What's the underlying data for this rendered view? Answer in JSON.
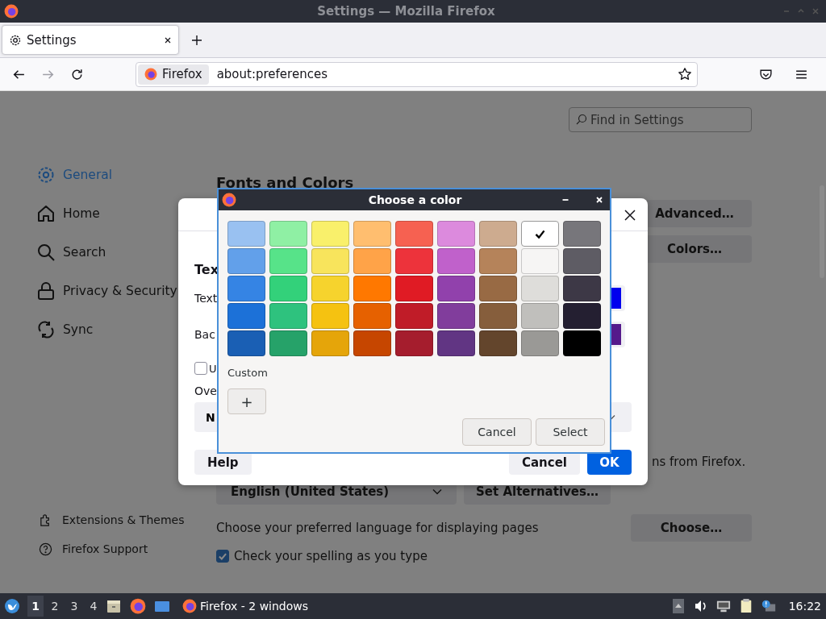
{
  "window": {
    "title": "Settings — Mozilla Firefox"
  },
  "tabs": [
    {
      "label": "Settings",
      "selected": true
    }
  ],
  "navigation": {
    "forward_disabled": true
  },
  "url_bar": {
    "identity": "Firefox",
    "value": "about:preferences"
  },
  "search": {
    "placeholder": "Find in Settings"
  },
  "sidebar": {
    "items": [
      {
        "label": "General",
        "kind": "gear",
        "selected": true
      },
      {
        "label": "Home",
        "kind": "home",
        "selected": false
      },
      {
        "label": "Search",
        "kind": "search",
        "selected": false
      },
      {
        "label": "Privacy & Security",
        "kind": "lock",
        "selected": false
      },
      {
        "label": "Sync",
        "kind": "sync",
        "selected": false
      }
    ],
    "footer": [
      {
        "label": "Extensions & Themes",
        "kind": "puzzle"
      },
      {
        "label": "Firefox Support",
        "kind": "help"
      }
    ]
  },
  "content": {
    "heading": "Fonts and Colors",
    "side_buttons": [
      "Advanced…",
      "Colors…"
    ],
    "partial_text": "ns from Firefox.",
    "language_dropdown": "English (United States)",
    "alternatives_button": "Set Alternatives…",
    "language_prompt": "Choose your preferred language for displaying pages",
    "choose_button": "Choose…",
    "spellcheck": {
      "label": "Check your spelling as you type",
      "checked": true
    }
  },
  "fonts_dialog": {
    "heading": "Tex",
    "color_rows": [
      {
        "label": "Text",
        "color": "#0000ee"
      },
      {
        "label": "Bac",
        "color": "#551a8b"
      }
    ],
    "checkbox": {
      "label": "U",
      "checked": false
    },
    "override_label": "Ove",
    "override_select": "N",
    "help": "Help",
    "cancel": "Cancel",
    "ok": "OK"
  },
  "color_chooser": {
    "title": "Choose a color",
    "swatch_rows": [
      [
        {
          "color": "#99c1f1",
          "selected": false
        },
        {
          "color": "#8ff0a4",
          "selected": false
        },
        {
          "color": "#f9f06b",
          "selected": false
        },
        {
          "color": "#ffbe6f",
          "selected": false
        },
        {
          "color": "#f66151",
          "selected": false
        },
        {
          "color": "#dc8add",
          "selected": false
        },
        {
          "color": "#cdab8f",
          "selected": false
        },
        {
          "color": "#ffffff",
          "selected": true
        },
        {
          "color": "#77767b",
          "selected": false
        }
      ],
      [
        {
          "color": "#62a0ea",
          "selected": false
        },
        {
          "color": "#57e389",
          "selected": false
        },
        {
          "color": "#f8e45c",
          "selected": false
        },
        {
          "color": "#ffa348",
          "selected": false
        },
        {
          "color": "#ed333b",
          "selected": false
        },
        {
          "color": "#c061cb",
          "selected": false
        },
        {
          "color": "#b5835a",
          "selected": false
        },
        {
          "color": "#f6f5f4",
          "selected": false
        },
        {
          "color": "#5e5c64",
          "selected": false
        }
      ],
      [
        {
          "color": "#3584e4",
          "selected": false
        },
        {
          "color": "#33d17a",
          "selected": false
        },
        {
          "color": "#f6d32d",
          "selected": false
        },
        {
          "color": "#ff7800",
          "selected": false
        },
        {
          "color": "#e01b24",
          "selected": false
        },
        {
          "color": "#9141ac",
          "selected": false
        },
        {
          "color": "#986a44",
          "selected": false
        },
        {
          "color": "#deddda",
          "selected": false
        },
        {
          "color": "#3d3846",
          "selected": false
        }
      ],
      [
        {
          "color": "#1c71d8",
          "selected": false
        },
        {
          "color": "#2ec27e",
          "selected": false
        },
        {
          "color": "#f5c211",
          "selected": false
        },
        {
          "color": "#e66100",
          "selected": false
        },
        {
          "color": "#c01c28",
          "selected": false
        },
        {
          "color": "#813d9c",
          "selected": false
        },
        {
          "color": "#865e3c",
          "selected": false
        },
        {
          "color": "#c0bfbc",
          "selected": false
        },
        {
          "color": "#241f31",
          "selected": false
        }
      ],
      [
        {
          "color": "#1a5fb4",
          "selected": false
        },
        {
          "color": "#26a269",
          "selected": false
        },
        {
          "color": "#e5a50a",
          "selected": false
        },
        {
          "color": "#c64600",
          "selected": false
        },
        {
          "color": "#a51d2d",
          "selected": false
        },
        {
          "color": "#613583",
          "selected": false
        },
        {
          "color": "#63452c",
          "selected": false
        },
        {
          "color": "#9a9996",
          "selected": false
        },
        {
          "color": "#000000",
          "selected": false
        }
      ]
    ],
    "custom_label": "Custom",
    "add_custom": "+",
    "cancel": "Cancel",
    "select": "Select"
  },
  "taskbar": {
    "workspaces": [
      {
        "label": "1",
        "selected": true
      },
      {
        "label": "2",
        "selected": false
      },
      {
        "label": "3",
        "selected": false
      },
      {
        "label": "4",
        "selected": false
      }
    ],
    "task": "Firefox - 2 windows",
    "clock": "16:22"
  }
}
